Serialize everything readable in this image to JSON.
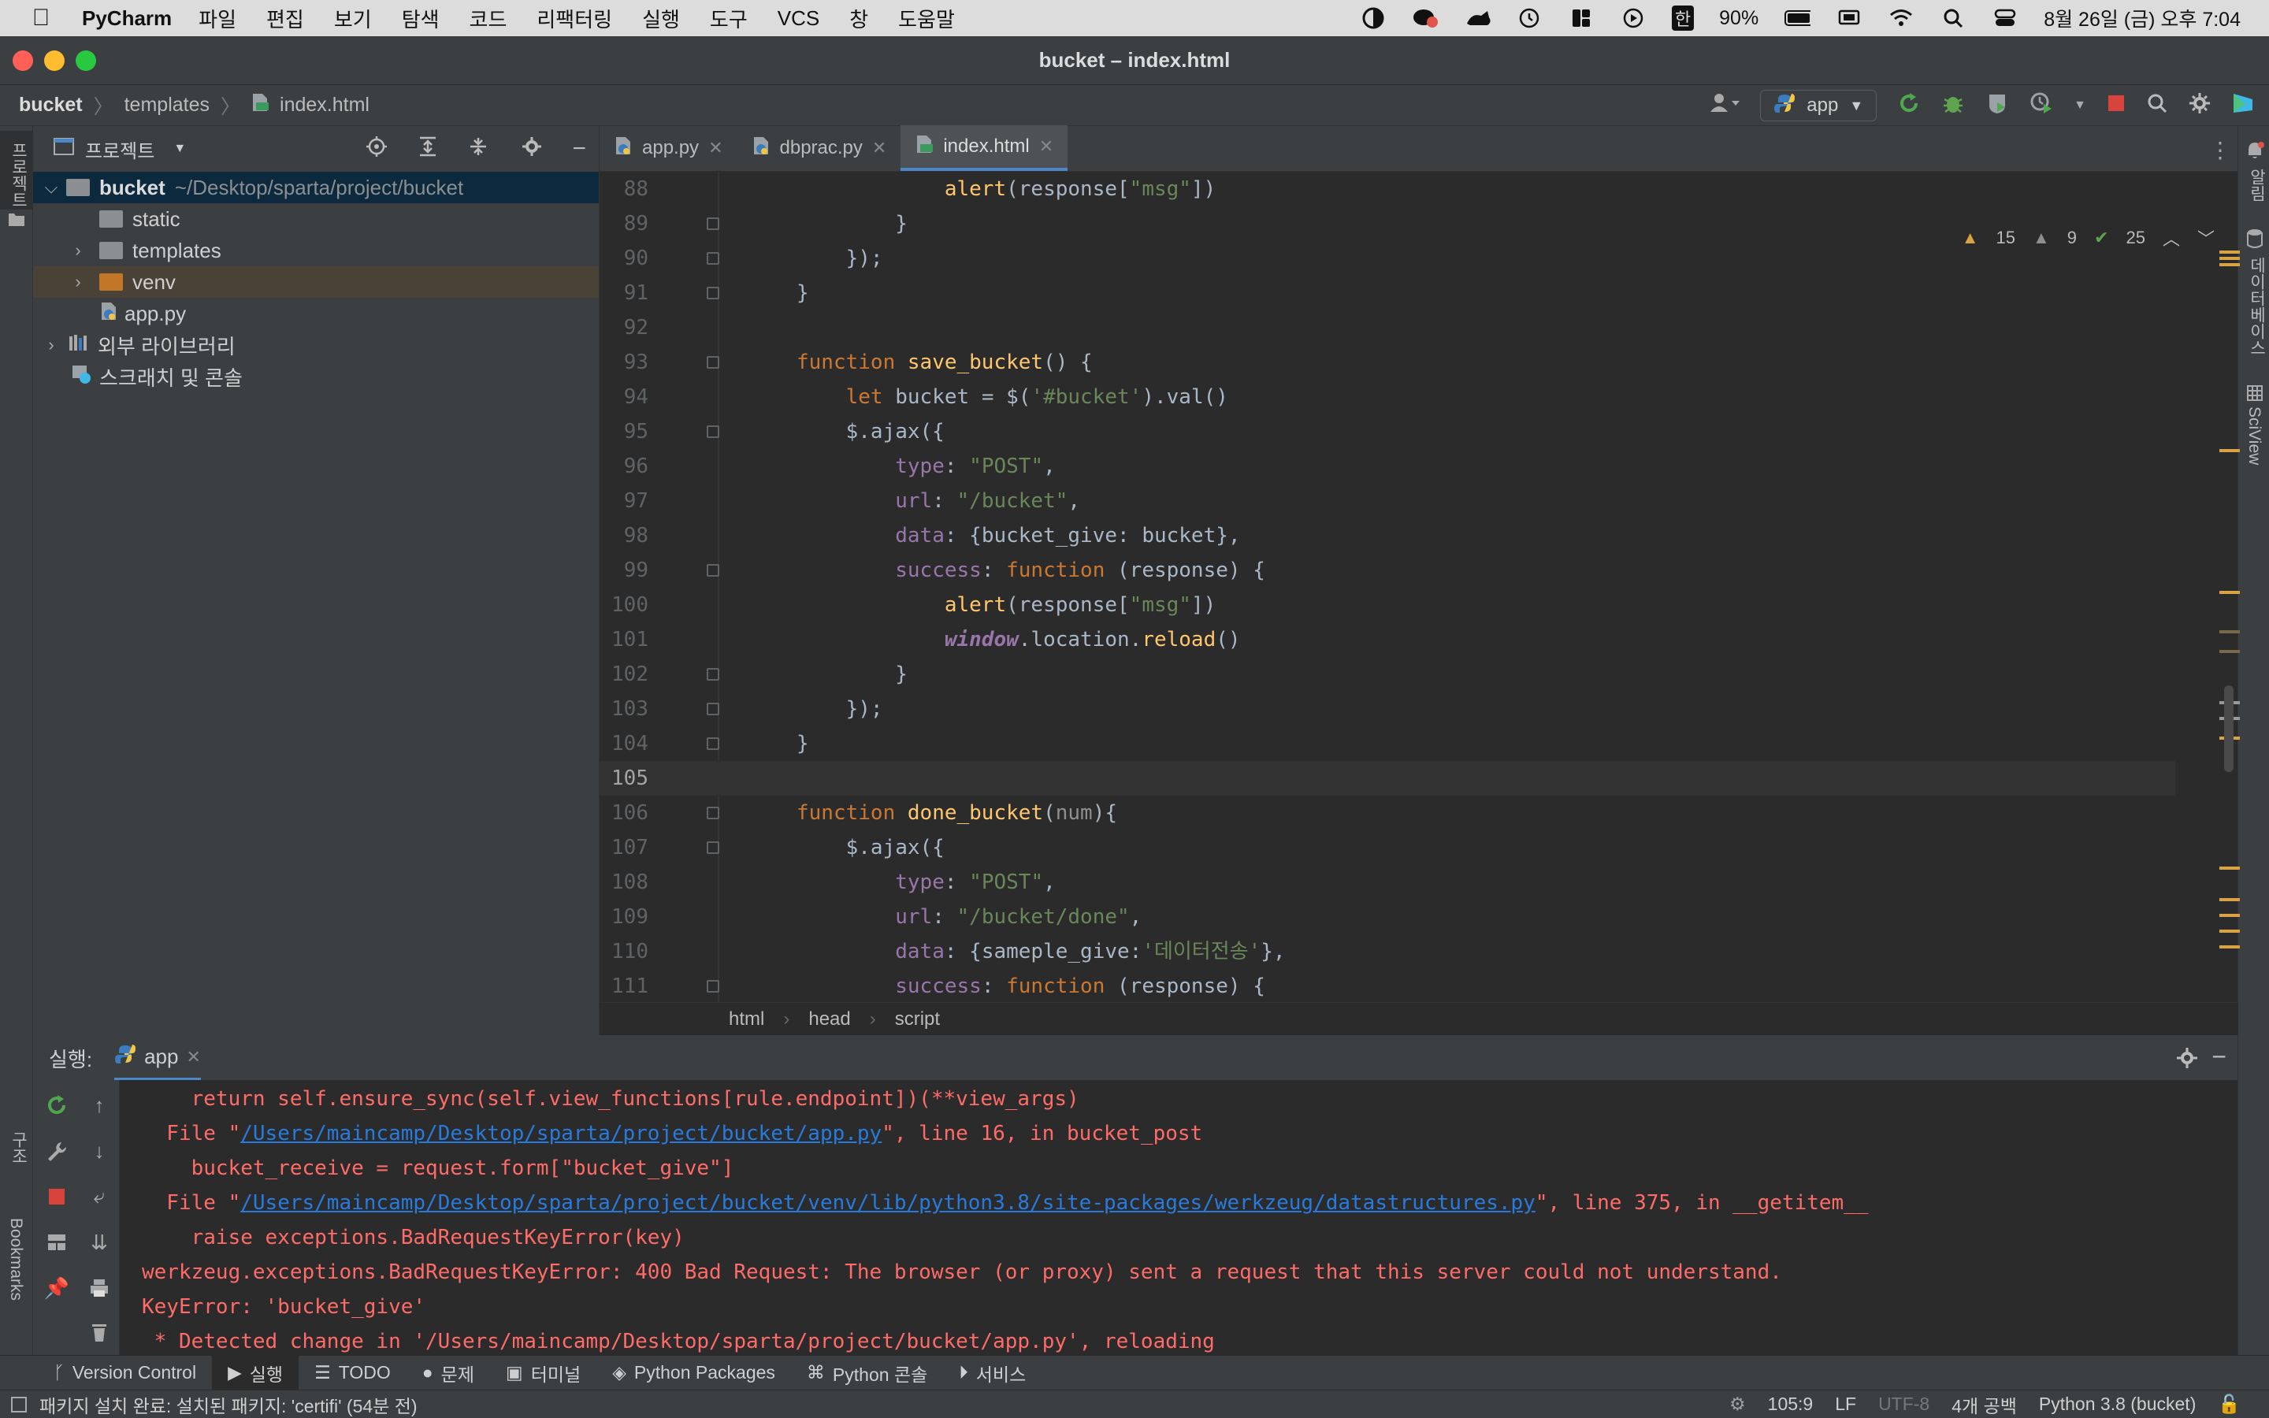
{
  "menubar": {
    "app": "PyCharm",
    "items": [
      "파일",
      "편집",
      "보기",
      "탐색",
      "코드",
      "리팩터링",
      "실행",
      "도구",
      "VCS",
      "창",
      "도움말"
    ],
    "battery": "90%",
    "datetime": "8월 26일 (금) 오후 7:04",
    "ime": "한"
  },
  "window": {
    "title": "bucket – index.html"
  },
  "breadcrumb": {
    "root": "bucket",
    "folder": "templates",
    "file": "index.html"
  },
  "toolbar": {
    "run_config": "app"
  },
  "left_strip": {
    "project_label": "프로젝트",
    "structure_label": "구조",
    "bookmarks_label": "Bookmarks"
  },
  "right_strip": {
    "notifications_label": "알림",
    "database_label": "데이터베이스",
    "sciview_label": "SciView"
  },
  "project": {
    "header": "프로젝트",
    "root_name": "bucket",
    "root_path": "~/Desktop/sparta/project/bucket",
    "items": [
      "static",
      "templates",
      "venv",
      "app.py"
    ],
    "external": "외부 라이브러리",
    "scratches": "스크래치 및 콘솔"
  },
  "tabs": [
    {
      "label": "app.py"
    },
    {
      "label": "dbprac.py"
    },
    {
      "label": "index.html"
    }
  ],
  "inspections": {
    "warnings": "15",
    "weak": "9",
    "ok": "25"
  },
  "code": {
    "lines": [
      {
        "n": "88",
        "t": "            alert(response[\"msg\"])"
      },
      {
        "n": "89",
        "t": "        }"
      },
      {
        "n": "90",
        "t": "    });"
      },
      {
        "n": "91",
        "t": "}"
      },
      {
        "n": "92",
        "t": ""
      },
      {
        "n": "93",
        "t": "function save_bucket() {"
      },
      {
        "n": "94",
        "t": "    let bucket = $('#bucket').val()"
      },
      {
        "n": "95",
        "t": "    $.ajax({"
      },
      {
        "n": "96",
        "t": "        type: \"POST\","
      },
      {
        "n": "97",
        "t": "        url: \"/bucket\","
      },
      {
        "n": "98",
        "t": "        data: {bucket_give: bucket},"
      },
      {
        "n": "99",
        "t": "        success: function (response) {"
      },
      {
        "n": "100",
        "t": "            alert(response[\"msg\"])"
      },
      {
        "n": "101",
        "t": "            window.location.reload()"
      },
      {
        "n": "102",
        "t": "        }"
      },
      {
        "n": "103",
        "t": "    });"
      },
      {
        "n": "104",
        "t": "}"
      },
      {
        "n": "105",
        "t": ""
      },
      {
        "n": "106",
        "t": "function done_bucket(num){"
      },
      {
        "n": "107",
        "t": "    $.ajax({"
      },
      {
        "n": "108",
        "t": "        type: \"POST\","
      },
      {
        "n": "109",
        "t": "        url: \"/bucket/done\","
      },
      {
        "n": "110",
        "t": "        data: {sameple_give:'데이터전송'},"
      },
      {
        "n": "111",
        "t": "        success: function (response) {"
      }
    ]
  },
  "editor_crumbs": [
    "html",
    "head",
    "script"
  ],
  "run": {
    "label": "실행:",
    "config": "app",
    "console": [
      "    return self.ensure_sync(self.view_functions[rule.endpoint])(**view_args)",
      "  File \"/Users/maincamp/Desktop/sparta/project/bucket/app.py\", line 16, in bucket_post",
      "    bucket_receive = request.form[\"bucket_give\"]",
      "  File \"/Users/maincamp/Desktop/sparta/project/bucket/venv/lib/python3.8/site-packages/werkzeug/datastructures.py\", line 375, in __getitem__",
      "    raise exceptions.BadRequestKeyError(key)",
      "werkzeug.exceptions.BadRequestKeyError: 400 Bad Request: The browser (or proxy) sent a request that this server could not understand.",
      "KeyError: 'bucket_give'",
      " * Detected change in '/Users/maincamp/Desktop/sparta/project/bucket/app.py', reloading"
    ]
  },
  "toolwindows": [
    "Version Control",
    "실행",
    "TODO",
    "문제",
    "터미널",
    "Python Packages",
    "Python 콘솔",
    "서비스"
  ],
  "status": {
    "message": "패키지 설치 완료: 설치된 패키지: 'certifi' (54분 전)",
    "position": "105:9",
    "line_sep": "LF",
    "encoding": "UTF-8",
    "indent": "4개 공백",
    "interpreter": "Python 3.8 (bucket)"
  },
  "colors": {
    "accent": "#4a88c7",
    "error": "#ff6b68",
    "keyword": "#cc7832",
    "function": "#ffc66d",
    "string": "#6a8759"
  }
}
